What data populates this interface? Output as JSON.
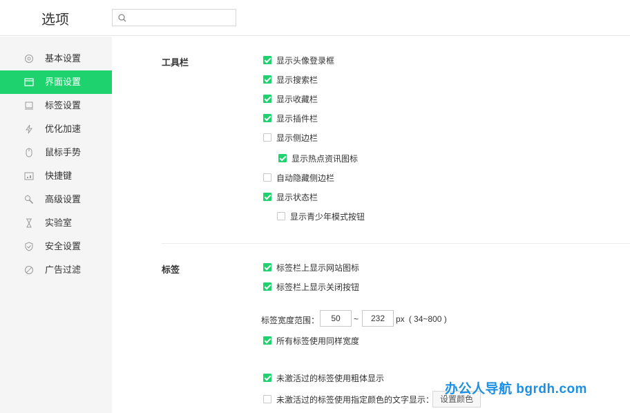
{
  "header": {
    "title": "选项",
    "search": {
      "placeholder": "",
      "value": ""
    }
  },
  "sidebar": {
    "items": [
      {
        "label": "基本设置",
        "icon": "gear-icon",
        "active": false
      },
      {
        "label": "界面设置",
        "icon": "window-icon",
        "active": true
      },
      {
        "label": "标签设置",
        "icon": "tab-icon",
        "active": false
      },
      {
        "label": "优化加速",
        "icon": "lightning-icon",
        "active": false
      },
      {
        "label": "鼠标手势",
        "icon": "mouse-icon",
        "active": false
      },
      {
        "label": "快捷键",
        "icon": "keyboard-icon",
        "active": false
      },
      {
        "label": "高级设置",
        "icon": "wrench-icon",
        "active": false
      },
      {
        "label": "实验室",
        "icon": "flask-icon",
        "active": false
      },
      {
        "label": "安全设置",
        "icon": "shield-icon",
        "active": false
      },
      {
        "label": "广告过滤",
        "icon": "block-icon",
        "active": false
      }
    ]
  },
  "toolbar_section": {
    "title": "工具栏",
    "options": [
      {
        "label": "显示头像登录框",
        "checked": true
      },
      {
        "label": "显示搜索栏",
        "checked": true
      },
      {
        "label": "显示收藏栏",
        "checked": true
      },
      {
        "label": "显示插件栏",
        "checked": true
      },
      {
        "label": "显示侧边栏",
        "checked": false
      },
      {
        "label": "显示热点资讯图标",
        "checked": true
      },
      {
        "label": "自动隐藏侧边栏",
        "checked": false
      },
      {
        "label": "显示状态栏",
        "checked": true
      },
      {
        "label": "显示青少年模式按钮",
        "checked": false
      }
    ]
  },
  "tabs_section": {
    "title": "标签",
    "options": [
      {
        "label": "标签栏上显示网站图标",
        "checked": true
      },
      {
        "label": "标签栏上显示关闭按钮",
        "checked": true
      },
      {
        "label": "所有标签使用同样宽度",
        "checked": true
      },
      {
        "label": "未激活过的标签使用粗体显示",
        "checked": true
      },
      {
        "label": "未激活过的标签使用指定颜色的文字显示：",
        "checked": false
      }
    ],
    "width_range": {
      "label": "标签宽度范围：",
      "min": "50",
      "separator": "~",
      "max": "232",
      "unit": "px",
      "hint": "( 34~800 )"
    },
    "set_color_button": "设置颜色"
  },
  "watermark": "办公人导航  bgrdh.com",
  "colors": {
    "accent": "#1ed26e",
    "watermark": "#1a8fe3"
  }
}
